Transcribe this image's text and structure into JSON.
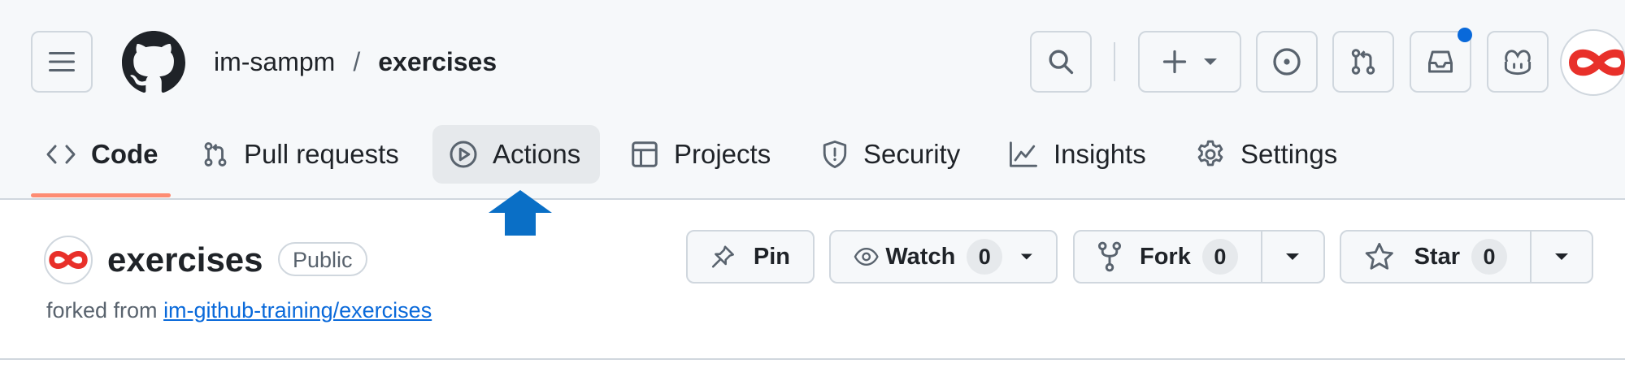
{
  "header": {
    "owner": "im-sampm",
    "separator": "/",
    "repo": "exercises",
    "notification_color": "#0969da",
    "icons": [
      "hamburger-menu-icon",
      "github-logo-icon",
      "search-icon",
      "plus-icon",
      "chevron-down-icon",
      "issue-icon",
      "pull-request-icon",
      "inbox-icon",
      "copilot-icon",
      "avatar"
    ]
  },
  "tabs": [
    {
      "label": "Code",
      "icon": "code-icon"
    },
    {
      "label": "Pull requests",
      "icon": "git-pull-request-icon"
    },
    {
      "label": "Actions",
      "icon": "play-circle-icon"
    },
    {
      "label": "Projects",
      "icon": "table-icon"
    },
    {
      "label": "Security",
      "icon": "shield-icon"
    },
    {
      "label": "Insights",
      "icon": "graph-icon"
    },
    {
      "label": "Settings",
      "icon": "gear-icon"
    }
  ],
  "repo_title": {
    "name": "exercises",
    "visibility": "Public",
    "forked_prefix": "forked from",
    "forked_source": "im-github-training/exercises"
  },
  "actions": {
    "pin_label": "Pin",
    "watch_label": "Watch",
    "watch_count": "0",
    "fork_label": "Fork",
    "fork_count": "0",
    "star_label": "Star",
    "star_count": "0"
  },
  "colors": {
    "accent_underline": "#fd8c73",
    "annotation_arrow": "#0a6fc6",
    "link": "#0969da",
    "avatar_brand": "#e8302a"
  }
}
